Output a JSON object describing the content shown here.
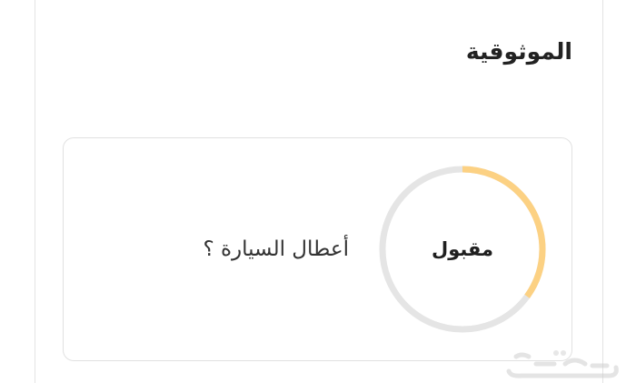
{
  "section": {
    "title": "الموثوقية"
  },
  "card": {
    "question": "أعطال السيارة ؟",
    "status_label": "مقبول",
    "progress_fraction": 0.35,
    "colors": {
      "track": "#e5e5e5",
      "progress": "#fcd183"
    }
  },
  "watermark": {
    "icon": "haraj-logo-watermark"
  }
}
